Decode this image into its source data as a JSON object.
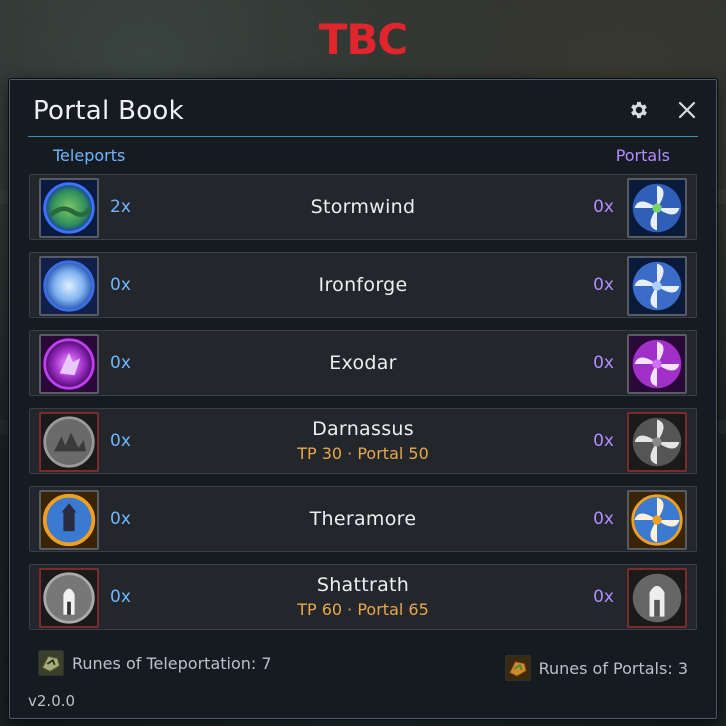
{
  "app": {
    "badge": "TBC",
    "badge_color": "#e0262c"
  },
  "window": {
    "title": "Portal Book",
    "settings_icon": "gear-icon",
    "close_icon": "close-icon"
  },
  "columns": {
    "teleports_label": "Teleports",
    "portals_label": "Portals"
  },
  "destinations": [
    {
      "name": "Stormwind",
      "teleport_count": "2x",
      "portal_count": "0x",
      "requirement": "",
      "locked": false,
      "icon": "stormwind-icon"
    },
    {
      "name": "Ironforge",
      "teleport_count": "0x",
      "portal_count": "0x",
      "requirement": "",
      "locked": false,
      "icon": "ironforge-icon"
    },
    {
      "name": "Exodar",
      "teleport_count": "0x",
      "portal_count": "0x",
      "requirement": "",
      "locked": false,
      "icon": "exodar-icon"
    },
    {
      "name": "Darnassus",
      "teleport_count": "0x",
      "portal_count": "0x",
      "requirement": "TP 30 · Portal 50",
      "locked": true,
      "icon": "darnassus-icon"
    },
    {
      "name": "Theramore",
      "teleport_count": "0x",
      "portal_count": "0x",
      "requirement": "",
      "locked": false,
      "icon": "theramore-icon"
    },
    {
      "name": "Shattrath",
      "teleport_count": "0x",
      "portal_count": "0x",
      "requirement": "TP 60 · Portal 65",
      "locked": true,
      "icon": "shattrath-icon"
    }
  ],
  "footer": {
    "runes_teleportation": "Runes of Teleportation: 7",
    "runes_portals": "Runes of Portals: 3",
    "version": "v2.0.0"
  },
  "colors": {
    "teleport_accent": "#6fb6ff",
    "portal_accent": "#b28cff",
    "requirement": "#e8a84a",
    "locked_border": "#7a2c2c"
  }
}
